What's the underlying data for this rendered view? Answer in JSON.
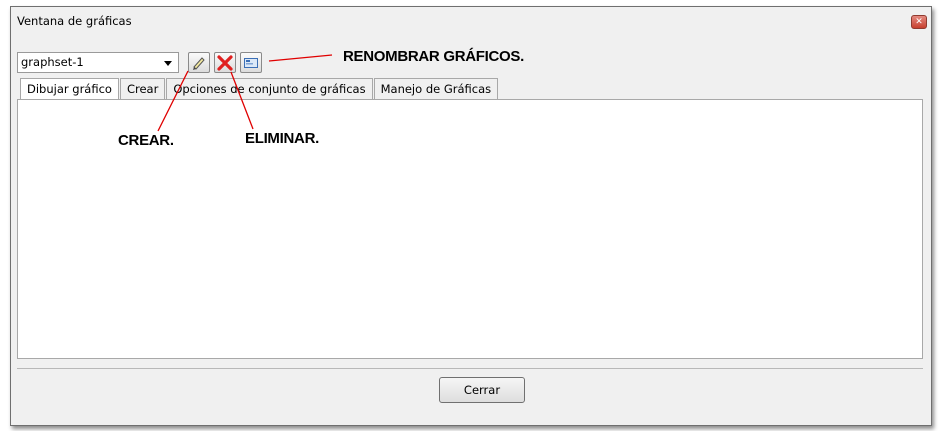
{
  "window": {
    "title": "Ventana de gráficas",
    "close_icon": "close-icon"
  },
  "toolbar": {
    "combo_value": "graphset-1",
    "create_icon": "pencil-icon",
    "delete_icon": "red-x-icon",
    "rename_icon": "rename-icon"
  },
  "tabs": [
    {
      "label": "Dibujar gráfico",
      "active": true
    },
    {
      "label": "Crear"
    },
    {
      "label": "Opciones de conjunto de gráficas"
    },
    {
      "label": "Manejo de Gráficas"
    }
  ],
  "footer": {
    "close_label": "Cerrar"
  },
  "annotations": {
    "rename": "RENOMBRAR GRÁFICOS.",
    "create": "CREAR.",
    "delete": "ELIMINAR."
  },
  "colors": {
    "delete_red": "#e02020",
    "title_close": "#c8402f"
  }
}
